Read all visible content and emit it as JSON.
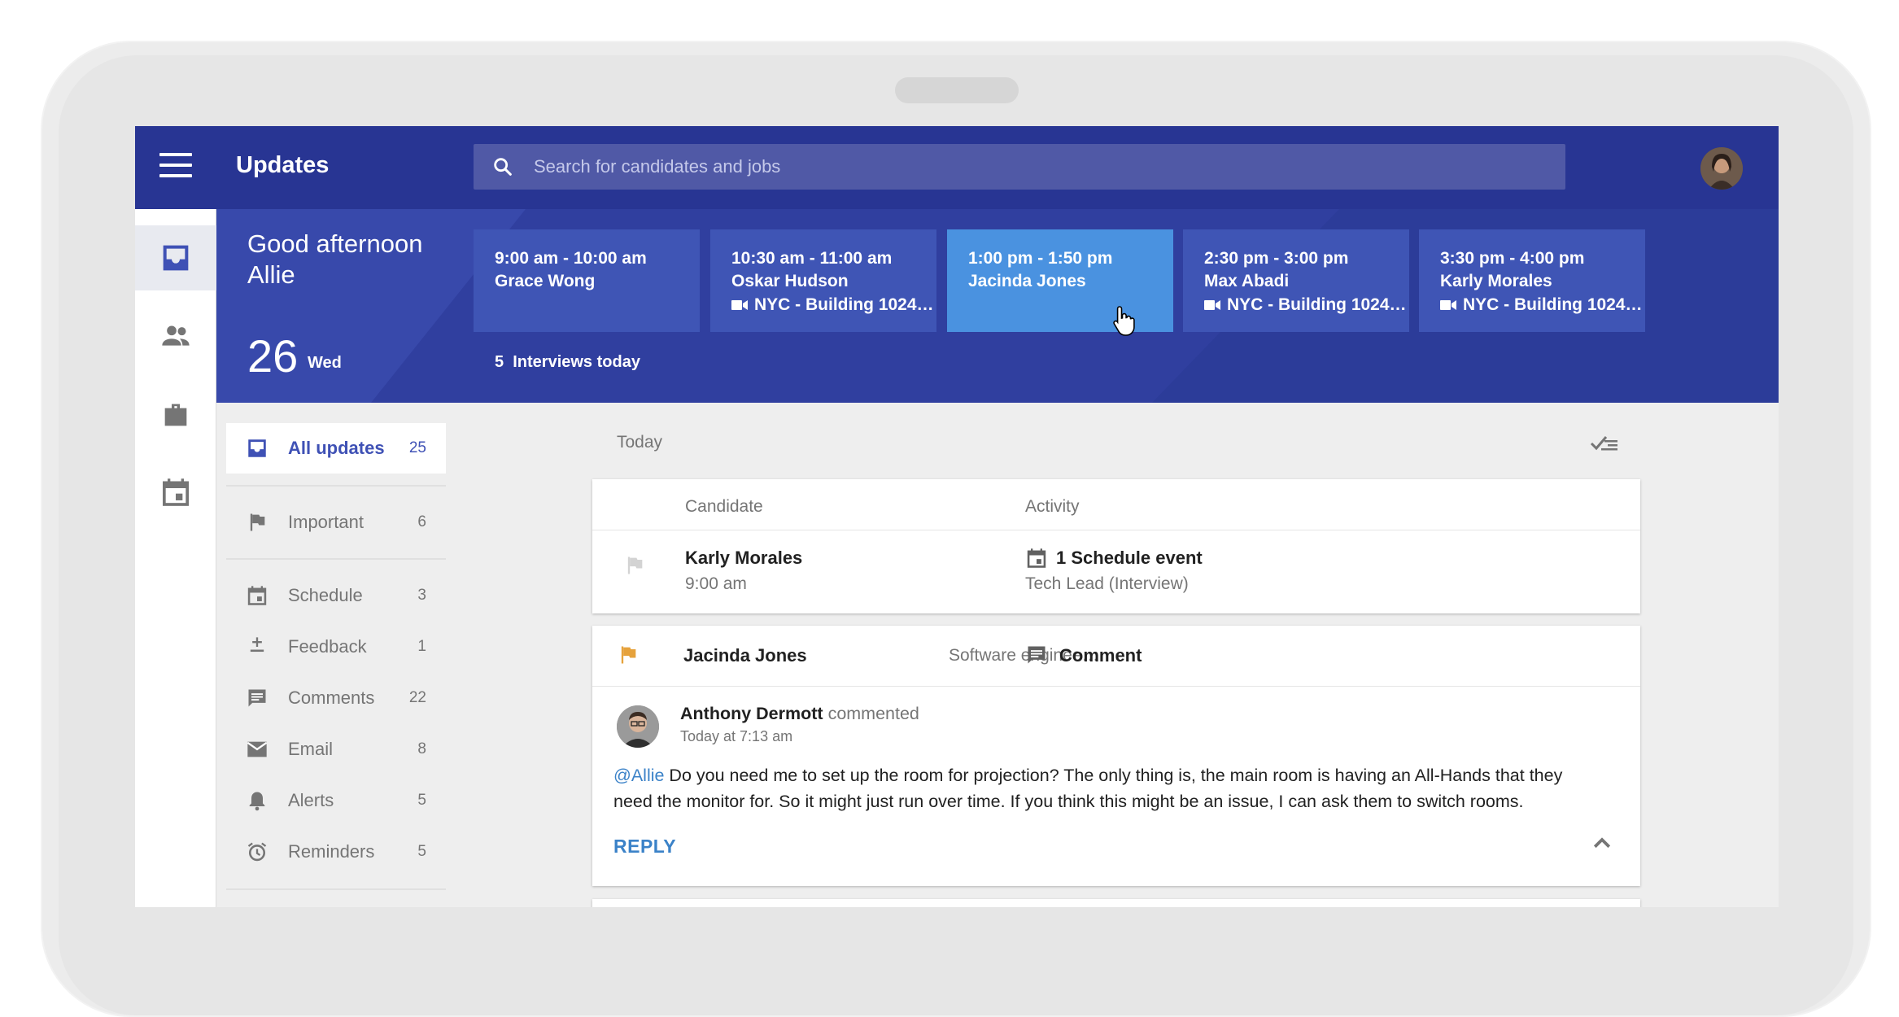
{
  "app": {
    "title": "Updates",
    "search_placeholder": "Search for candidates and jobs"
  },
  "hero": {
    "greeting": "Good afternoon Allie",
    "date_number": "26",
    "date_day": "Wed",
    "interviews_today": "5  Interviews today",
    "interviews": [
      {
        "time": "9:00 am - 10:00 am",
        "name": "Grace Wong",
        "location": ""
      },
      {
        "time": "10:30 am - 11:00 am",
        "name": "Oskar Hudson",
        "location": "NYC - Building 1024…"
      },
      {
        "time": "1:00 pm - 1:50 pm",
        "name": "Jacinda Jones",
        "location": ""
      },
      {
        "time": "2:30 pm - 3:00 pm",
        "name": "Max Abadi",
        "location": "NYC - Building 1024…"
      },
      {
        "time": "3:30 pm - 4:00 pm",
        "name": "Karly Morales",
        "location": "NYC - Building 1024…"
      }
    ]
  },
  "nav": {
    "items": [
      {
        "label": "All updates",
        "count": "25",
        "icon": "inbox-icon"
      },
      {
        "label": "Important",
        "count": "6",
        "icon": "flag-icon"
      },
      {
        "label": "Schedule",
        "count": "3",
        "icon": "calendar-icon"
      },
      {
        "label": "Feedback",
        "count": "1",
        "icon": "feedback-icon"
      },
      {
        "label": "Comments",
        "count": "22",
        "icon": "comment-icon"
      },
      {
        "label": "Email",
        "count": "8",
        "icon": "email-icon"
      },
      {
        "label": "Alerts",
        "count": "5",
        "icon": "bell-icon"
      },
      {
        "label": "Reminders",
        "count": "5",
        "icon": "alarm-icon"
      }
    ]
  },
  "feed": {
    "section_label": "Today",
    "table_headers": {
      "candidate": "Candidate",
      "activity": "Activity"
    },
    "row1": {
      "candidate": "Karly Morales",
      "time": "9:00 am",
      "activity": "1 Schedule event",
      "activity_detail": "Tech Lead (Interview)"
    },
    "row2": {
      "candidate": "Jacinda Jones",
      "role": "Software enginee…",
      "activity": "Comment",
      "commenter": "Anthony Dermott",
      "commented_word": "commented",
      "comment_time": "Today at 7:13 am",
      "mention": "@Allie",
      "comment_body": " Do you need me to set up the room for projection? The only thing is, the main room is having an All-Hands that they need the monitor for. So it might just run over time. If you think this might be an issue, I can ask them to switch rooms.",
      "reply_label": "REPLY"
    }
  },
  "colors": {
    "appbar": "#283593",
    "hero": "#303f9f",
    "selected_card": "#4a92e0",
    "accent": "#3f51b5",
    "flag_important": "#e6a23c"
  }
}
